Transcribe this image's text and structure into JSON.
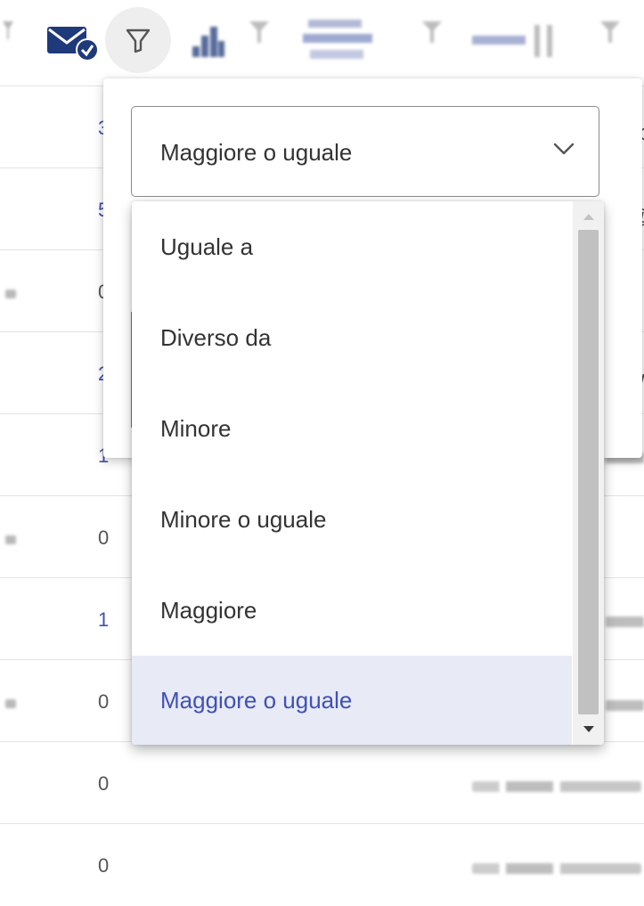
{
  "operator_select": {
    "selected_value": "Maggiore o uguale"
  },
  "operator_options": [
    {
      "label": "Uguale a"
    },
    {
      "label": "Diverso da"
    },
    {
      "label": "Minore"
    },
    {
      "label": "Minore o uguale"
    },
    {
      "label": "Maggiore"
    },
    {
      "label": "Maggiore o uguale",
      "selected": true
    }
  ],
  "table": {
    "rows": [
      {
        "count": "3",
        "style": "link"
      },
      {
        "count": "5",
        "style": "link"
      },
      {
        "count": "0",
        "style": "plain"
      },
      {
        "count": "2",
        "style": "link"
      },
      {
        "count": "1",
        "style": "link"
      },
      {
        "count": "0",
        "style": "plain"
      },
      {
        "count": "1",
        "style": "link"
      },
      {
        "count": "0",
        "style": "plain"
      },
      {
        "count": "0",
        "style": "plain"
      },
      {
        "count": "0",
        "style": "plain"
      }
    ]
  },
  "edge_text": {
    "row1": "oc",
    "row2": "@",
    "row4": "wi"
  },
  "colors": {
    "accent": "#3f51b5",
    "selected_bg": "#e8eaf6",
    "text": "#333333",
    "divider": "#e3e3e3"
  },
  "icons": [
    "mail-check-icon",
    "filter-icon",
    "bar-chart-icon"
  ]
}
